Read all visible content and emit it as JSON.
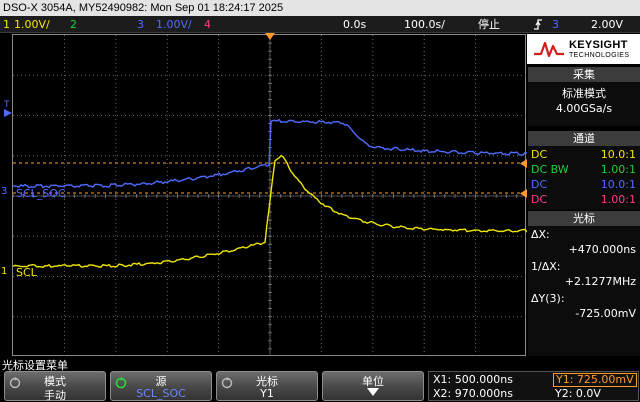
{
  "titlebar": {
    "text": "DSO-X 3054A, MY52490982: Mon Sep 01 18:24:17 2025"
  },
  "status": {
    "ch1_num": "1",
    "ch1_scale": "1.00V/",
    "ch2_num": "2",
    "ch3_num": "3",
    "ch3_scale": "1.00V/",
    "ch4_num": "4",
    "time_delay": "0.0s",
    "time_scale": "100.0s/",
    "run_state": "停止",
    "trigger_icon": "trigger-edge-icon",
    "trigger_source": "3",
    "trigger_level": "2.00V"
  },
  "colors": {
    "ch1": "#f2e600",
    "ch2": "#1fcf3a",
    "ch3": "#4f6bff",
    "ch4": "#ff3b8a",
    "cursor": "#ff9a2a",
    "grid": "#6a6a6a"
  },
  "waveform_labels": {
    "ch1": "SCL",
    "ch3": "SCL_SOC"
  },
  "trigger_marker": {
    "label": "T"
  },
  "panel": {
    "brand": "KEYSIGHT",
    "brand_sub": "TECHNOLOGIES",
    "acq_head": "采集",
    "acq_mode": "标准模式",
    "acq_rate": "4.00GSa/s",
    "chan_head": "通道",
    "channels": [
      {
        "coupling": "DC",
        "probe": "10.0:1"
      },
      {
        "coupling": "DC BW",
        "probe": "1.00:1"
      },
      {
        "coupling": "DC",
        "probe": "10.0:1"
      },
      {
        "coupling": "DC",
        "probe": "1.00:1"
      }
    ],
    "cursor_head": "光标",
    "dx_label": "ΔX:",
    "dx_value": "+470.000ns",
    "inv_dx_label": "1/ΔX:",
    "inv_dx_value": "+2.1277MHz",
    "dy_label": "ΔY(3):",
    "dy_value": "-725.00mV"
  },
  "menu": {
    "title": "光标设置菜单",
    "softkeys": [
      {
        "label": "模式",
        "value": "手动"
      },
      {
        "label": "源",
        "value": "SCL_SOC"
      },
      {
        "label": "光标",
        "value": "Y1"
      },
      {
        "label": "单位",
        "value": ""
      }
    ]
  },
  "cursor_readout": {
    "x1": "X1: 500.000ns",
    "y1": "Y1: 725.00mV",
    "x2": "X2: 970.000ns",
    "y2": "Y2: 0.0V"
  }
}
